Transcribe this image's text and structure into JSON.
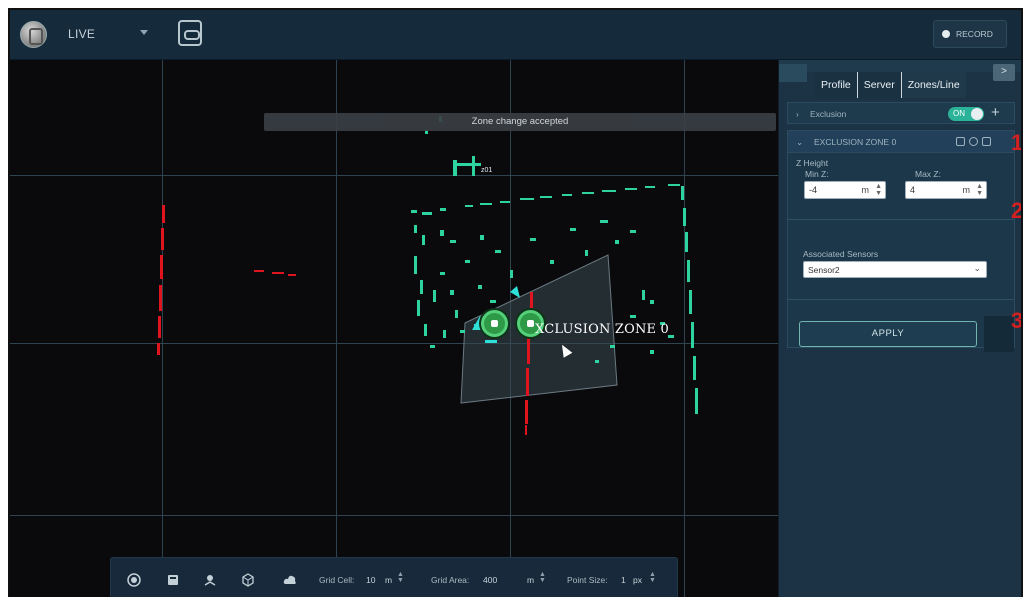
{
  "topbar": {
    "mode": "LIVE",
    "record_label": "RECORD"
  },
  "viewport": {
    "toast": "Zone change accepted",
    "zone_label": "XCLUSION ZONE 0",
    "small_label": "z01",
    "accent_colors": {
      "points": "#2dd4a0",
      "pole": "#e0141e",
      "zone_fill": "#3a4a52",
      "handle": "#2e9a48"
    }
  },
  "toolbar": {
    "grid_cell_label": "Grid Cell:",
    "grid_cell_value": "10",
    "grid_cell_unit": "m",
    "grid_area_label": "Grid Area:",
    "grid_area_value": "400",
    "grid_area_unit": "m",
    "point_size_label": "Point Size:",
    "point_size_value": "1",
    "point_size_unit": "px"
  },
  "panel": {
    "tabs": [
      {
        "label": "Profile"
      },
      {
        "label": "Server"
      },
      {
        "label": "Zones/Line"
      }
    ],
    "collapse_glyph": ">",
    "exclusion_row_label": "Exclusion",
    "toggle_label": "ON",
    "zone_header": "EXCLUSION ZONE 0",
    "z_height_label": "Z Height",
    "min_z_label": "Min Z:",
    "min_z_value": "-4",
    "min_z_unit": "m",
    "max_z_label": "Max Z:",
    "max_z_value": "4",
    "max_z_unit": "m",
    "sensors_label": "Associated Sensors",
    "sensor_value": "Sensor2",
    "apply_label": "APPLY"
  },
  "annotations": [
    "1",
    "2",
    "3"
  ]
}
